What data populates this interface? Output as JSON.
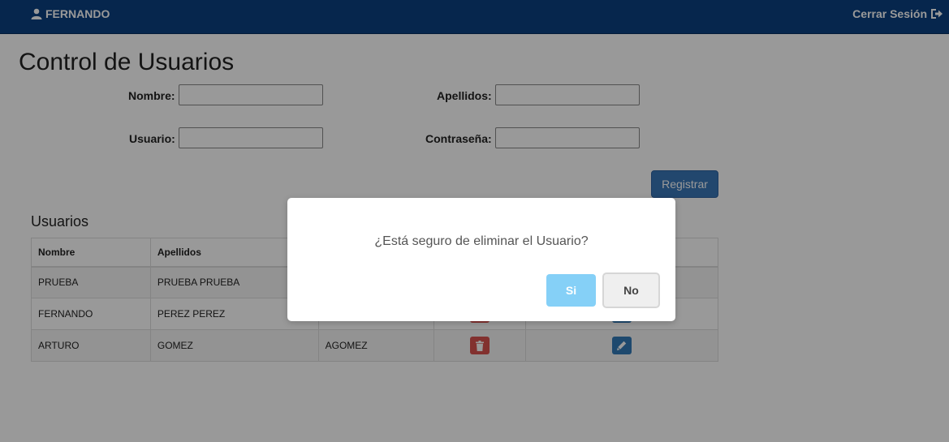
{
  "navbar": {
    "user_name": "FERNANDO",
    "logout_label": "Cerrar Sesión"
  },
  "page": {
    "title": "Control de Usuarios"
  },
  "form": {
    "nombre_label": "Nombre:",
    "apellidos_label": "Apellidos:",
    "usuario_label": "Usuario:",
    "contrasena_label": "Contraseña:",
    "nombre_value": "",
    "apellidos_value": "",
    "usuario_value": "",
    "contrasena_value": "",
    "register_label": "Registrar"
  },
  "users_section": {
    "title": "Usuarios",
    "headers": [
      "Nombre",
      "Apellidos"
    ],
    "rows": [
      {
        "nombre": "PRUEBA",
        "apellidos": "PRUEBA PRUEBA",
        "usuario": ""
      },
      {
        "nombre": "FERNANDO",
        "apellidos": "PEREZ PEREZ",
        "usuario": ""
      },
      {
        "nombre": "ARTURO",
        "apellidos": "GOMEZ",
        "usuario": "AGOMEZ"
      }
    ]
  },
  "modal": {
    "message": "¿Está seguro de eliminar el Usuario?",
    "confirm_label": "Si",
    "cancel_label": "No"
  },
  "icons": {
    "user": "user-icon",
    "logout": "sign-out-icon",
    "delete": "trash-icon",
    "edit": "pencil-icon"
  },
  "colors": {
    "navbar": "#0a4080",
    "primary_button": "#3a77b7",
    "delete_button": "#d9534f",
    "edit_button": "#337ab7",
    "modal_confirm": "#85d0f7"
  }
}
